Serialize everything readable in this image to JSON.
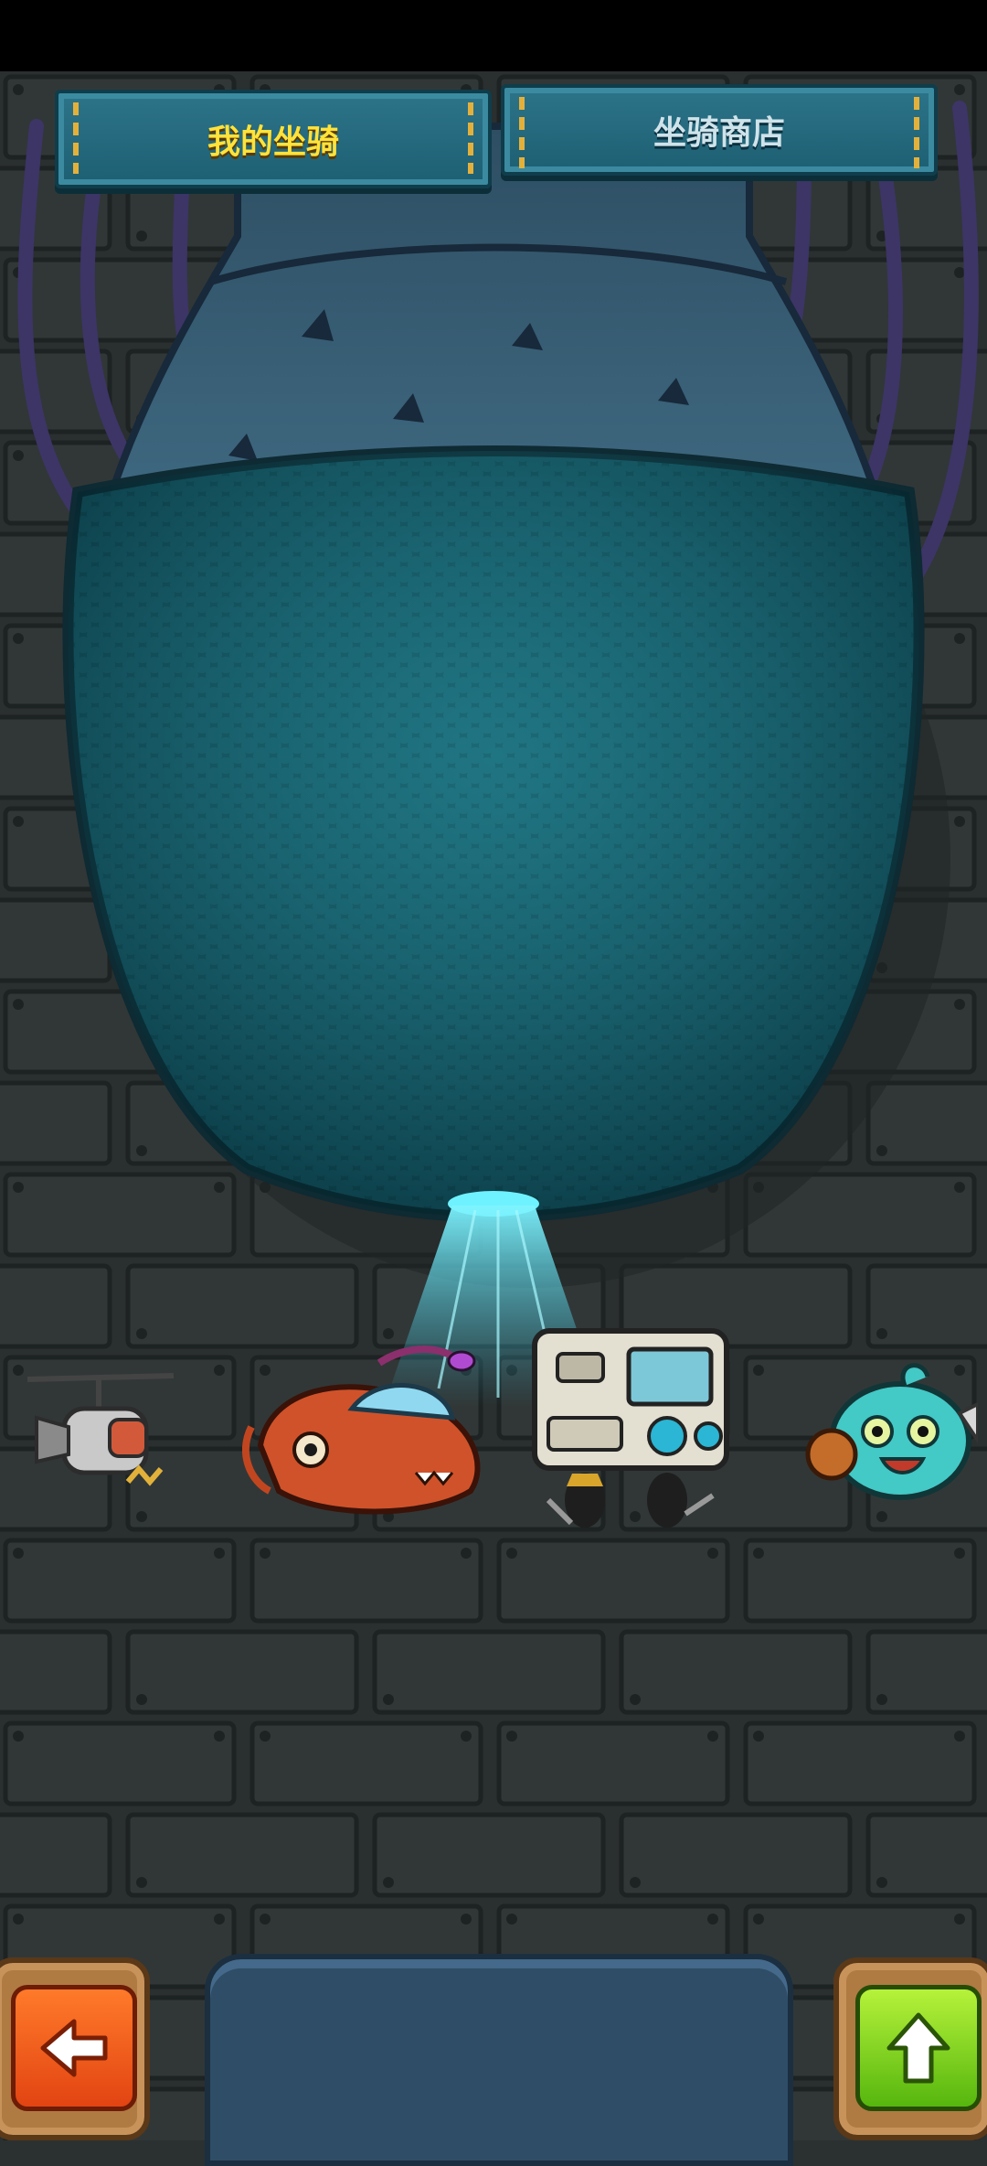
{
  "tabs": {
    "my_mounts": "我的坐骑",
    "mount_shop": "坐骑商店"
  },
  "icons": {
    "back": "arrow-left-icon",
    "upgrade": "arrow-up-icon"
  },
  "colors": {
    "tab_active_text": "#ffe23a",
    "tab_inactive_text": "#cfe3ea",
    "back_button": "#f05a1c",
    "upgrade_button": "#7fd41f",
    "beam": "#4fe7ff"
  }
}
